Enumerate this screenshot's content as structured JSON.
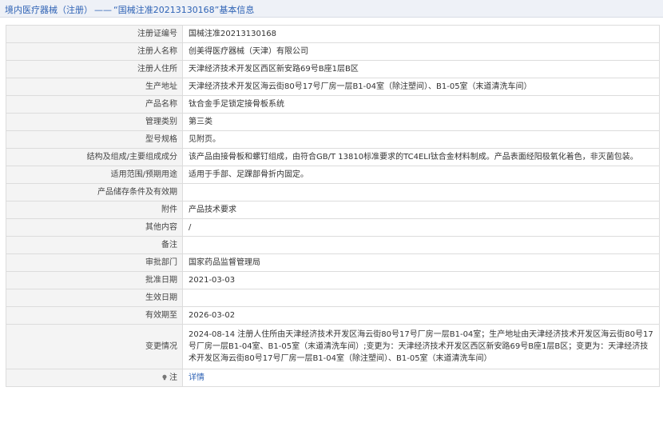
{
  "header": {
    "category": "境内医疗器械（注册）",
    "separator": "——",
    "record_title": "“国械注准20213130168”基本信息"
  },
  "rows": [
    {
      "label": "注册证编号",
      "value": "国械注准20213130168"
    },
    {
      "label": "注册人名称",
      "value": "创美得医疗器械（天津）有限公司"
    },
    {
      "label": "注册人住所",
      "value": "天津经济技术开发区西区新安路69号B座1层B区"
    },
    {
      "label": "生产地址",
      "value": "天津经济技术开发区海云街80号17号厂房一层B1-04室（除注塑间）、B1-05室（末道清洗车间）"
    },
    {
      "label": "产品名称",
      "value": "钛合金手足锁定接骨板系统"
    },
    {
      "label": "管理类别",
      "value": "第三类"
    },
    {
      "label": "型号规格",
      "value": "见附页。"
    },
    {
      "label": "结构及组成/主要组成成分",
      "value": "该产品由接骨板和螺钉组成，由符合GB/T 13810标准要求的TC4ELI钛合金材料制成。产品表面经阳极氧化着色，非灭菌包装。"
    },
    {
      "label": "适用范围/预期用途",
      "value": "适用于手部、足踝部骨折内固定。"
    },
    {
      "label": "产品储存条件及有效期",
      "value": ""
    },
    {
      "label": "附件",
      "value": "产品技术要求"
    },
    {
      "label": "其他内容",
      "value": "/"
    },
    {
      "label": "备注",
      "value": ""
    },
    {
      "label": "审批部门",
      "value": "国家药品监督管理局"
    },
    {
      "label": "批准日期",
      "value": "2021-03-03"
    },
    {
      "label": "生效日期",
      "value": ""
    },
    {
      "label": "有效期至",
      "value": "2026-03-02"
    },
    {
      "label": "变更情况",
      "value": "2024-08-14 注册人住所由天津经济技术开发区海云街80号17号厂房一层B1-04室；生产地址由天津经济技术开发区海云街80号17号厂房一层B1-04室、B1-05室（末道清洗车间）;变更为：天津经济技术开发区西区新安路69号B座1层B区；变更为：天津经济技术开发区海云街80号17号厂房一层B1-04室（除注塑间）、B1-05室（末道清洗车间）"
    }
  ],
  "note_row": {
    "label": "注",
    "icon": "lightbulb-icon",
    "link_text": "详情"
  }
}
